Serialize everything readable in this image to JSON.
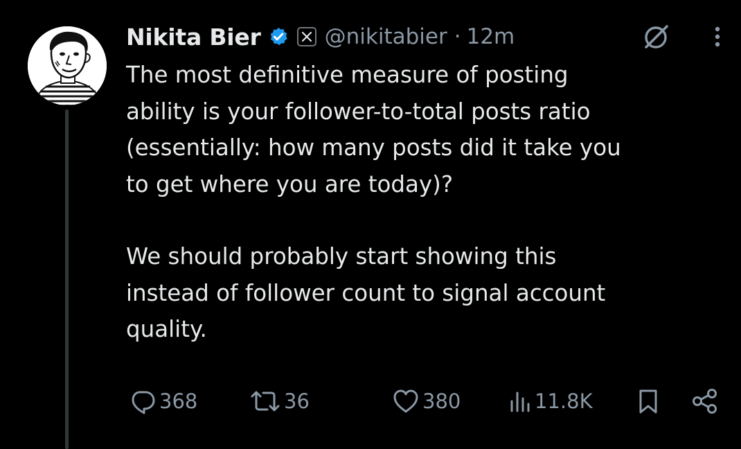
{
  "author": {
    "display_name": "Nikita Bier",
    "handle": "@nikitabier",
    "separator": "·",
    "time": "12m"
  },
  "icons": {
    "verified": "verified-badge-icon",
    "affiliate": "x-logo-icon",
    "grok": "grok-icon",
    "more": "more-vertical-icon",
    "reply": "reply-icon",
    "repost": "repost-icon",
    "like": "heart-icon",
    "views": "views-icon",
    "bookmark": "bookmark-icon",
    "share": "share-icon"
  },
  "tweet": {
    "paragraph_1": "The most definitive measure of posting\nability is your follower-to-total posts ratio\n(essentially: how many posts did it take you\nto get where you are today)?",
    "paragraph_2": "We should probably start showing this\ninstead of follower count to signal account\nquality."
  },
  "metrics": {
    "replies": "368",
    "reposts": "36",
    "likes": "380",
    "views": "11.8K"
  },
  "colors": {
    "background": "#000000",
    "text": "#e7e9ea",
    "muted": "#8b98a5",
    "verified": "#1d9bf0",
    "thread_line": "#333639"
  }
}
